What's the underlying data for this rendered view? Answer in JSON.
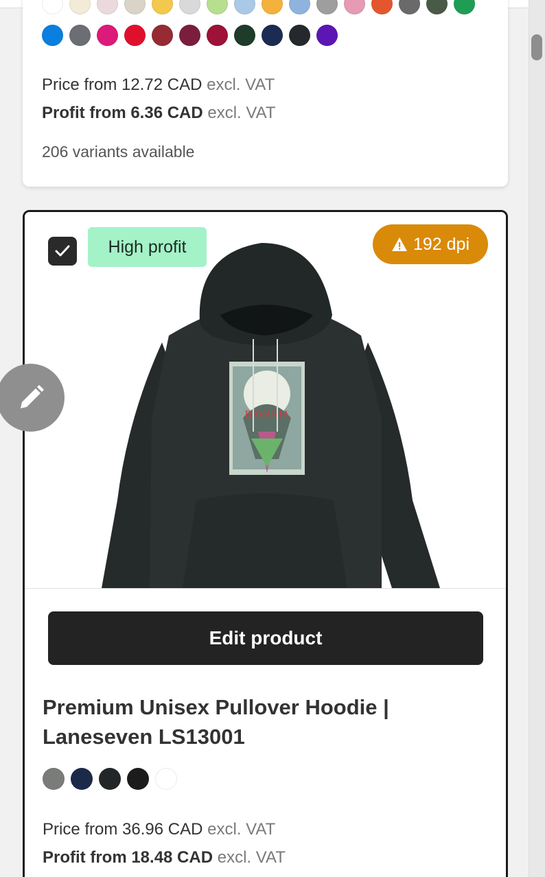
{
  "card_top": {
    "swatches_top_row": [
      "#ffffff",
      "#f3ead8",
      "#eadadd",
      "#d9d3c8",
      "#f2c94c",
      "#d9d9d9",
      "#b6df8f",
      "#a9c9e6",
      "#f4b13c",
      "#8fb3df",
      "#9e9e9e",
      "#e79ab3",
      "#e4572e",
      "#6a6a6a",
      "#4a5a48",
      "#1f9d55"
    ],
    "swatches_main_row": [
      "#0a7fe0",
      "#6b6e72",
      "#dc1a78",
      "#e0102c",
      "#962b34",
      "#7b1e3e",
      "#9c1238",
      "#1f3b2a",
      "#1b2b52",
      "#25282c",
      "#5b16b3"
    ],
    "price_prefix": "Price from",
    "price_value": "12.72 CAD",
    "price_suffix": "excl. VAT",
    "profit_label": "Profit from 6.36 CAD",
    "profit_suffix": "excl. VAT",
    "variants": "206 variants available"
  },
  "product_card": {
    "checkbox_checked": true,
    "profit_badge": "High profit",
    "dpi_badge": "192 dpi",
    "edit_button": "Edit product",
    "title": "Premium Unisex Pullover Hoodie | Laneseven LS13001",
    "swatches": [
      "#7a7c7a",
      "#1c2a4a",
      "#222628",
      "#1c1c1c",
      "#ffffff"
    ],
    "price_prefix": "Price from",
    "price_value": "36.96 CAD",
    "price_suffix": "excl. VAT",
    "profit_label": "Profit from 18.48 CAD",
    "profit_suffix": "excl. VAT"
  },
  "icons": {
    "edit_fab": "pencil-icon",
    "checkbox": "check-icon",
    "dpi": "warning-icon"
  }
}
